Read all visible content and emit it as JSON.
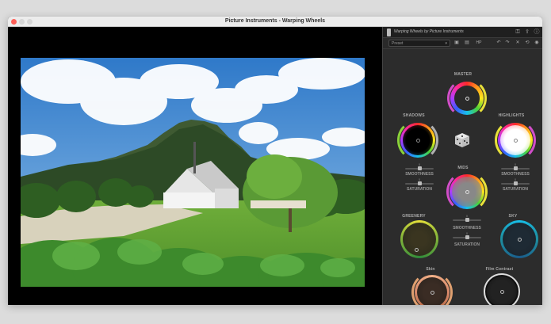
{
  "window": {
    "title": "Picture Instruments - Warping Wheels"
  },
  "panel": {
    "title": "Warping Wheels by Picture Instruments",
    "preset_label": "Preset",
    "toolbar_value": "HP"
  },
  "wheels": {
    "master": "MASTER",
    "shadows": "SHADOWS",
    "highlights": "HIGHLIGHTS",
    "mids": "MIDS",
    "greenery": "GREENERY",
    "sky": "SKY",
    "skin": "Skin",
    "film_contrast": "Film Contrast"
  },
  "sliders": {
    "smoothness": "SMOOTHNESS",
    "saturation": "SATURATION",
    "zero": "0"
  },
  "colors": {
    "panel_bg": "#2c2c2c",
    "sky_ring": "#1e8ea0",
    "greenery_ring": "#7fb23a",
    "skin_ring": "#d98a6a"
  }
}
